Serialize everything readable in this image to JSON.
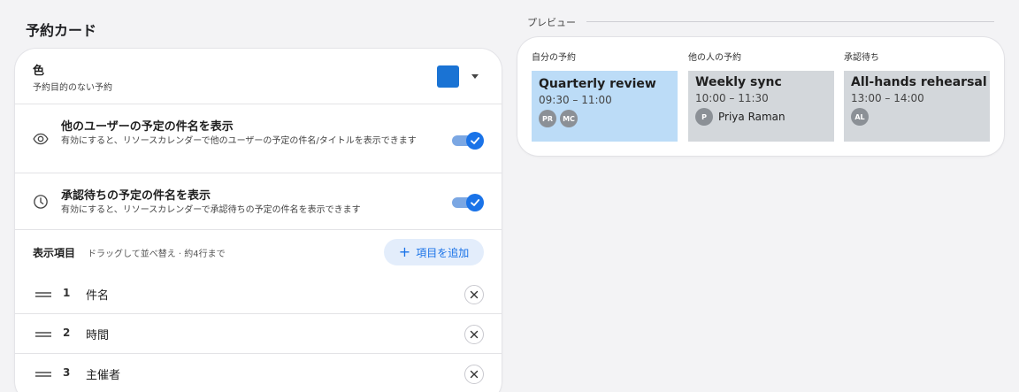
{
  "page": {
    "title": "予約カード"
  },
  "color_setting": {
    "title": "色",
    "subtitle": "予約目的のない予約",
    "swatch_color": "#1a73d4"
  },
  "toggles": [
    {
      "icon": "eye-icon",
      "title": "他のユーザーの予定の件名を表示",
      "description": "有効にすると、リソースカレンダーで他のユーザーの予定の件名/タイトルを表示できます",
      "enabled": true
    },
    {
      "icon": "clock-icon",
      "title": "承認待ちの予定の件名を表示",
      "description": "有効にすると、リソースカレンダーで承認待ちの予定の件名を表示できます",
      "enabled": true
    }
  ],
  "items": {
    "title": "表示項目",
    "hint": "ドラッグして並べ替え · 約4行まで",
    "add_label": "項目を追加",
    "list": [
      {
        "num": "1",
        "label": "件名"
      },
      {
        "num": "2",
        "label": "時間"
      },
      {
        "num": "3",
        "label": "主催者"
      }
    ]
  },
  "preview": {
    "label": "プレビュー",
    "columns": [
      {
        "label": "自分の予約",
        "bg": "#bcdcf7",
        "event": {
          "title": "Quarterly review",
          "time": "09:30 – 11:00",
          "chips": [
            "PR",
            "MC"
          ],
          "organizer": ""
        }
      },
      {
        "label": "他の人の予約",
        "bg": "#d3d7db",
        "event": {
          "title": "Weekly sync",
          "time": "10:00 – 11:30",
          "chips": [
            "P"
          ],
          "organizer": "Priya Raman"
        }
      },
      {
        "label": "承認待ち",
        "bg": "#d3d7db",
        "event": {
          "title": "All-hands rehearsal",
          "time": "13:00 – 14:00",
          "chips": [
            "AL"
          ],
          "organizer": ""
        }
      }
    ]
  }
}
